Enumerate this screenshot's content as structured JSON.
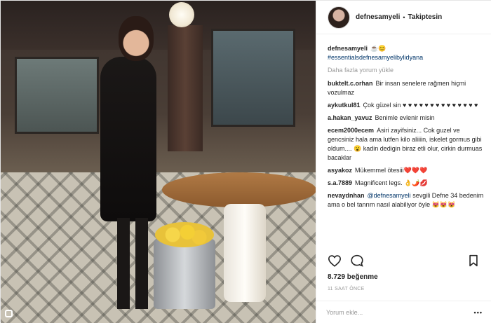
{
  "post": {
    "username": "defnesamyeli",
    "follow_status": "Takiptesin",
    "caption_user": "defnesamyeli",
    "caption_emoji": "☕😊",
    "caption_tag": "#essentialsdefnesamyelibylidyana",
    "load_more": "Daha fazla yorum yükle"
  },
  "comments": [
    {
      "user": "buktelt.c.orhan",
      "text": "Bir insan senelere rağmen hiçmi vozulmaz"
    },
    {
      "user": "aykutkul81",
      "text": "Çok güzel sin ♥ ♥ ♥ ♥ ♥ ♥ ♥ ♥ ♥ ♥ ♥ ♥ ♥ ♥"
    },
    {
      "user": "a.hakan_yavuz",
      "text": "Benimle evlenir misin"
    },
    {
      "user": "ecem2000ecem",
      "text": "Asiri zayifsiniz... Cok guzel ve gencsiniz hala ama lutfen kilo aliiiin, iskelet gormus gibi oldum.... 😮 kadin dedigin biraz etli olur, cirkin durmuas bacaklar"
    },
    {
      "user": "asyakoz",
      "text": "Mükemmel ötesiii❤️❤️❤️"
    },
    {
      "user": "s.a.7889",
      "text": "Magnificent legs. 👌🌶️💋"
    },
    {
      "user": "nevaydnhan",
      "mention": "@defnesamyeli",
      "text": "sevgili Defne 34 bedenim ama o bel tanrım nasıl alabiliyor öyle 😻😻😻"
    }
  ],
  "actions": {
    "like_icon": "heart-outline-icon",
    "comment_icon": "comment-bubble-icon",
    "save_icon": "bookmark-icon"
  },
  "likes": "8.729 beğenme",
  "time_ago": "11 SAAT ÖNCE",
  "add_comment_placeholder": "Yorum ekle...",
  "more_options": "•••",
  "colors": {
    "text": "#262626",
    "muted": "#999999",
    "hashtag": "#003569",
    "border": "#efefef"
  }
}
